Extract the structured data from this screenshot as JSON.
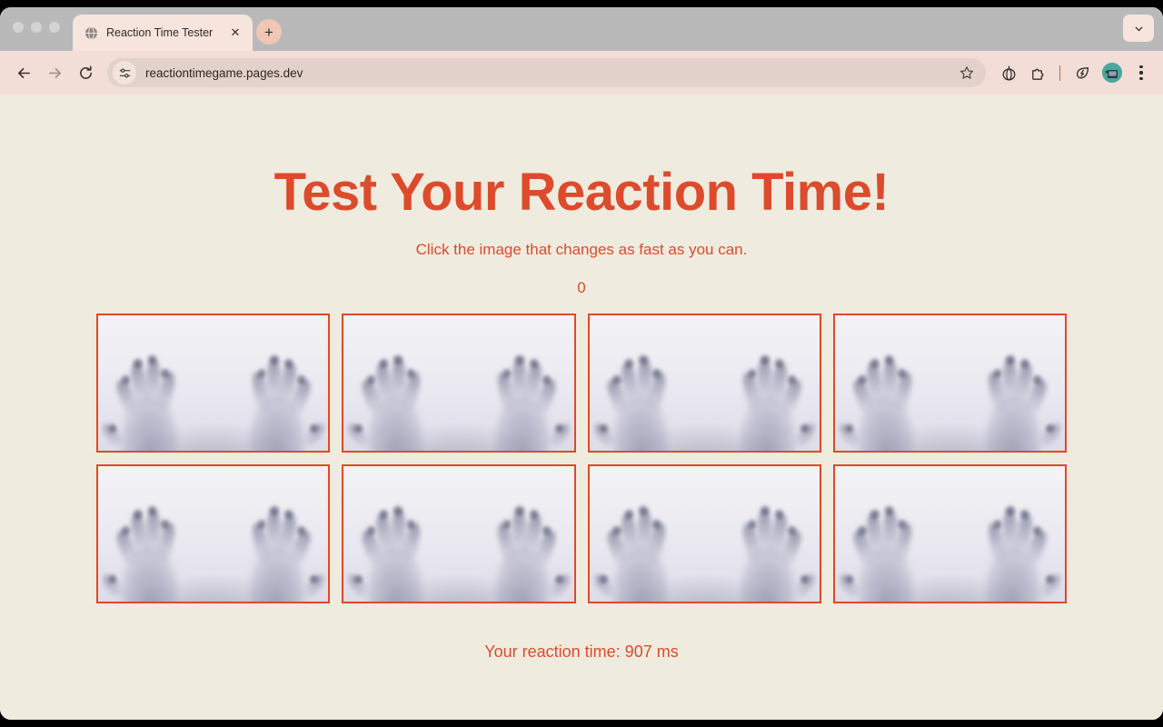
{
  "window": {
    "traffic_lights": [
      "close",
      "minimize",
      "maximize"
    ],
    "tabstrip_collapse_label": "⌄"
  },
  "tab": {
    "favicon": "globe-icon",
    "title": "Reaction Time Tester",
    "close_label": "✕",
    "new_tab_label": "+"
  },
  "toolbar": {
    "back_label": "←",
    "forward_label": "→",
    "reload_label": "⟳",
    "site_settings_icon": "tune-icon",
    "url": "reactiontimegame.pages.dev",
    "bookmark_icon": "star-icon",
    "pumpkin_icon": "pumpkin-icon",
    "extensions_icon": "extensions-puzzle-icon",
    "energy_saver_icon": "leaf-bolt-icon",
    "profile_icon": "profile-avatar",
    "menu_icon": "three-dot-menu-icon"
  },
  "page": {
    "title": "Test Your Reaction Time!",
    "subtitle": "Click the image that changes as fast as you can.",
    "score": "0",
    "status": "Your reaction time: 907 ms",
    "accent_color": "#dc4b2c",
    "tile_border_color": "#e04a22",
    "background_color": "#f0ebdf",
    "tiles": [
      {
        "label": "frosted-glass-hands-image-1"
      },
      {
        "label": "frosted-glass-hands-image-2"
      },
      {
        "label": "frosted-glass-hands-image-3"
      },
      {
        "label": "frosted-glass-hands-image-4"
      },
      {
        "label": "frosted-glass-hands-image-5"
      },
      {
        "label": "frosted-glass-hands-image-6"
      },
      {
        "label": "frosted-glass-hands-image-7"
      },
      {
        "label": "frosted-glass-hands-image-8"
      }
    ]
  }
}
